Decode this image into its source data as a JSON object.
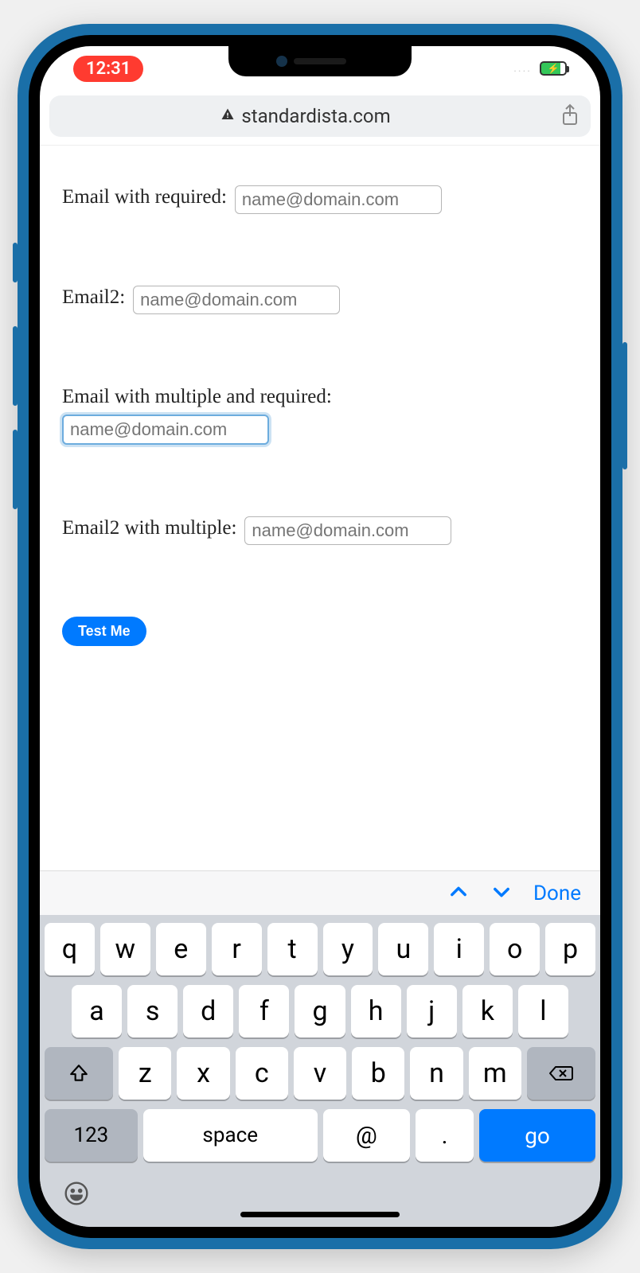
{
  "status": {
    "time": "12:31",
    "signal_dots": "....",
    "battery_charging": true
  },
  "browser": {
    "url_display": "standardista.com",
    "secure_warning": true
  },
  "form": {
    "fields": [
      {
        "label": "Email with required:",
        "placeholder": "name@domain.com",
        "focused": false,
        "block": false
      },
      {
        "label": "Email2:",
        "placeholder": "name@domain.com",
        "focused": false,
        "block": false
      },
      {
        "label": "Email with multiple and required:",
        "placeholder": "name@domain.com",
        "focused": true,
        "block": true
      },
      {
        "label": "Email2 with multiple:",
        "placeholder": "name@domain.com",
        "focused": false,
        "block": false
      }
    ],
    "submit_label": "Test Me"
  },
  "keyboard_toolbar": {
    "done_label": "Done"
  },
  "keyboard": {
    "row1": [
      "q",
      "w",
      "e",
      "r",
      "t",
      "y",
      "u",
      "i",
      "o",
      "p"
    ],
    "row2": [
      "a",
      "s",
      "d",
      "f",
      "g",
      "h",
      "j",
      "k",
      "l"
    ],
    "row3": [
      "z",
      "x",
      "c",
      "v",
      "b",
      "n",
      "m"
    ],
    "numeric_label": "123",
    "space_label": "space",
    "at_label": "@",
    "dot_label": ".",
    "go_label": "go"
  }
}
